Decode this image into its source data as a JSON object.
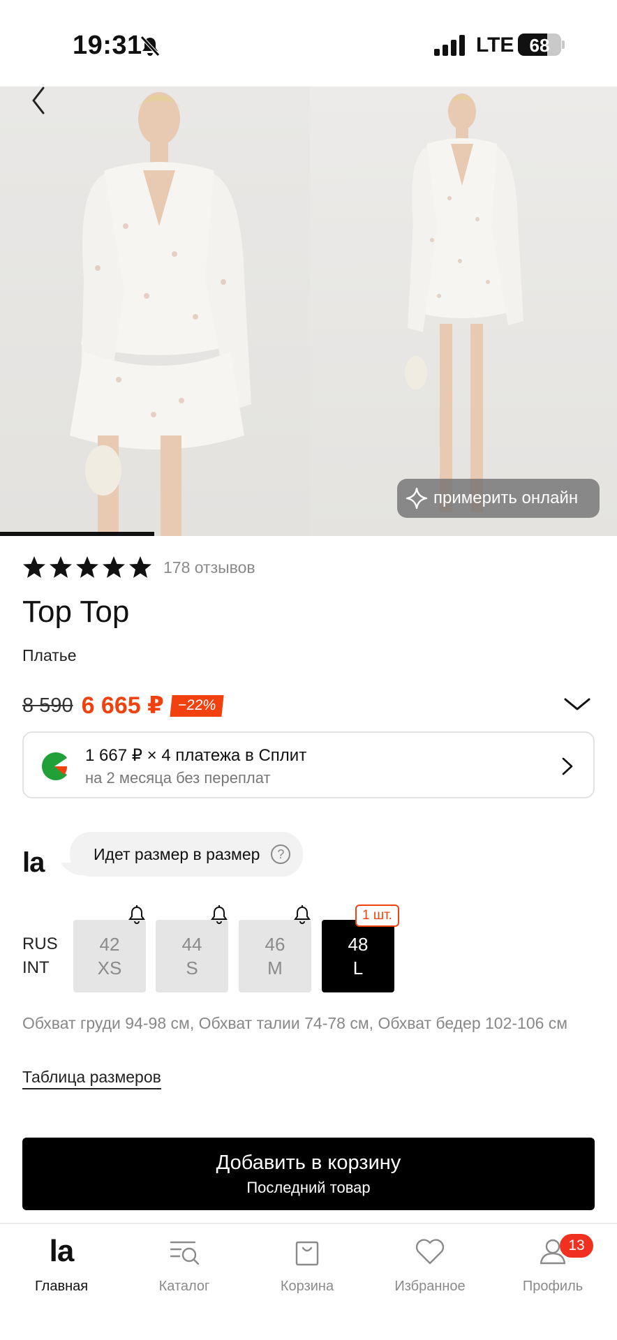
{
  "status_bar": {
    "time": "19:31",
    "network": "LTE",
    "battery": "68",
    "battery_level": 0.68
  },
  "gallery": {
    "try_on_label": "примерить онлайн",
    "progress_fraction": 0.25
  },
  "product": {
    "rating_stars": 5,
    "reviews": "178 отзывов",
    "brand": "Top Top",
    "category": "Платье",
    "old_price": "8 590",
    "new_price": "6 665 ₽",
    "discount": "−22%"
  },
  "split": {
    "line1": "1 667 ₽ × 4 платежа в Сплит",
    "line2": "на 2 месяца без переплат"
  },
  "fit": {
    "logo": "la",
    "text": "Идет размер в размер",
    "help": "?"
  },
  "sizes": {
    "system_rus": "RUS",
    "system_int": "INT",
    "options": [
      {
        "rus": "42",
        "int": "XS",
        "available": false
      },
      {
        "rus": "44",
        "int": "S",
        "available": false
      },
      {
        "rus": "46",
        "int": "M",
        "available": false
      },
      {
        "rus": "48",
        "int": "L",
        "available": true,
        "stock": "1 шт."
      }
    ],
    "measurements": "Обхват груди 94-98 см, Обхват талии 74-78 см, Обхват бедер 102-106 см",
    "size_table_link": "Таблица размеров"
  },
  "cart_button": {
    "label": "Добавить в корзину",
    "sublabel": "Последний товар"
  },
  "tab_bar": {
    "items": [
      {
        "label": "Главная",
        "icon": "la-logo-icon",
        "active": true
      },
      {
        "label": "Каталог",
        "icon": "catalog-search-icon"
      },
      {
        "label": "Корзина",
        "icon": "shopping-bag-icon"
      },
      {
        "label": "Избранное",
        "icon": "heart-icon"
      },
      {
        "label": "Профиль",
        "icon": "profile-icon",
        "badge": "13"
      }
    ]
  },
  "colors": {
    "accent": "#f0410f",
    "primary": "#000000",
    "badge": "#f0311f"
  }
}
